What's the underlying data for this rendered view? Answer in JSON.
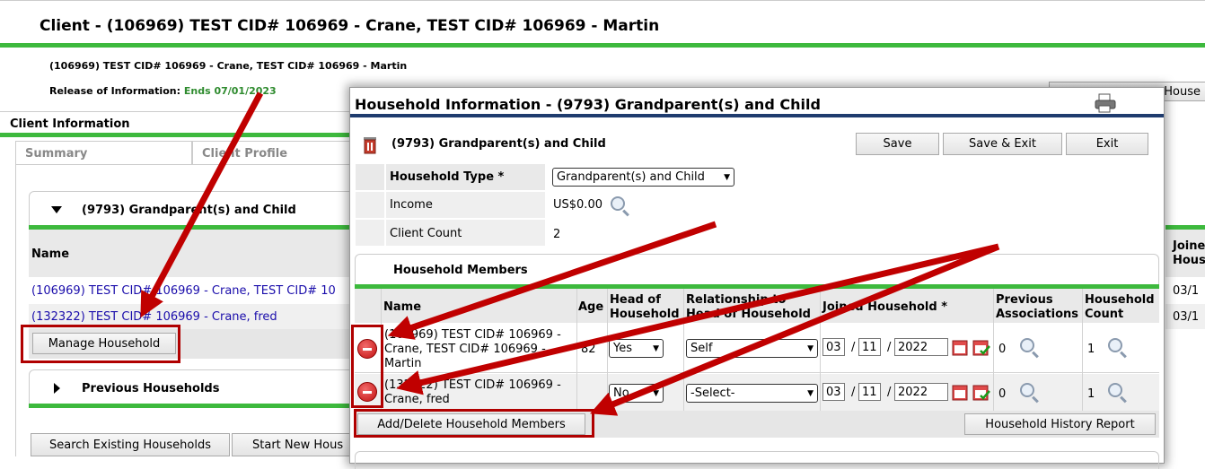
{
  "client_title": "Client - (106969) TEST CID# 106969 - Crane, TEST CID# 106969 - Martin",
  "client_subtitle": "(106969) TEST CID# 106969 - Crane, TEST CID# 106969 - Martin",
  "roi_label": "Release of Information:",
  "roi_value": "Ends 07/01/2023",
  "right_clipped_button": "House",
  "client_info_heading": "Client Information",
  "tabs": [
    "Summary",
    "Client Profile"
  ],
  "household_section": {
    "title": "(9793) Grandparent(s) and Child",
    "name_header": "Name",
    "members": [
      "(106969) TEST CID# 106969 - Crane, TEST CID# 10",
      "(132322) TEST CID# 106969 - Crane, fred"
    ],
    "manage_button": "Manage Household",
    "right_header": "Joine\nHous",
    "right_values": [
      "03/1",
      "03/1"
    ]
  },
  "previous_households": "Previous Households",
  "bottom_buttons": [
    "Search Existing Households",
    "Start New Hous"
  ],
  "modal": {
    "title": "Household Information - (9793) Grandparent(s) and Child",
    "subtitle": "(9793) Grandparent(s) and Child",
    "buttons": {
      "save": "Save",
      "save_exit": "Save & Exit",
      "exit": "Exit"
    },
    "fields": {
      "household_type_label": "Household Type",
      "household_type_value": "Grandparent(s) and Child",
      "income_label": "Income",
      "income_value": "US$0.00",
      "client_count_label": "Client Count",
      "client_count_value": "2"
    },
    "members_heading": "Household Members",
    "columns": {
      "name": "Name",
      "age": "Age",
      "head1": "Head of",
      "head2": "Household",
      "rel1": "Relationship to",
      "rel2": "Head of Household",
      "joined": "Joined Household",
      "prev1": "Previous",
      "prev2": "Associations",
      "count1": "Household",
      "count2": "Count"
    },
    "rows": [
      {
        "name_l1": "(106969) TEST CID# 106969 -",
        "name_l2": "Crane, TEST CID# 106969 -",
        "name_l3": "Martin",
        "age": "82",
        "head": "Yes",
        "relationship": "Self",
        "month": "03",
        "day": "11",
        "year": "2022",
        "prev": "0",
        "count": "1"
      },
      {
        "name_l1": "(132322) TEST CID# 106969 -",
        "name_l2": "Crane, fred",
        "age": "",
        "head": "No",
        "relationship": "-Select-",
        "month": "03",
        "day": "11",
        "year": "2022",
        "prev": "0",
        "count": "1"
      }
    ],
    "add_delete_button": "Add/Delete Household Members",
    "history_button": "Household History Report"
  },
  "colors": {
    "green": "#3db93d",
    "navy": "#1f3c6e",
    "arrow": "#c00000",
    "link": "#1a0dab"
  }
}
